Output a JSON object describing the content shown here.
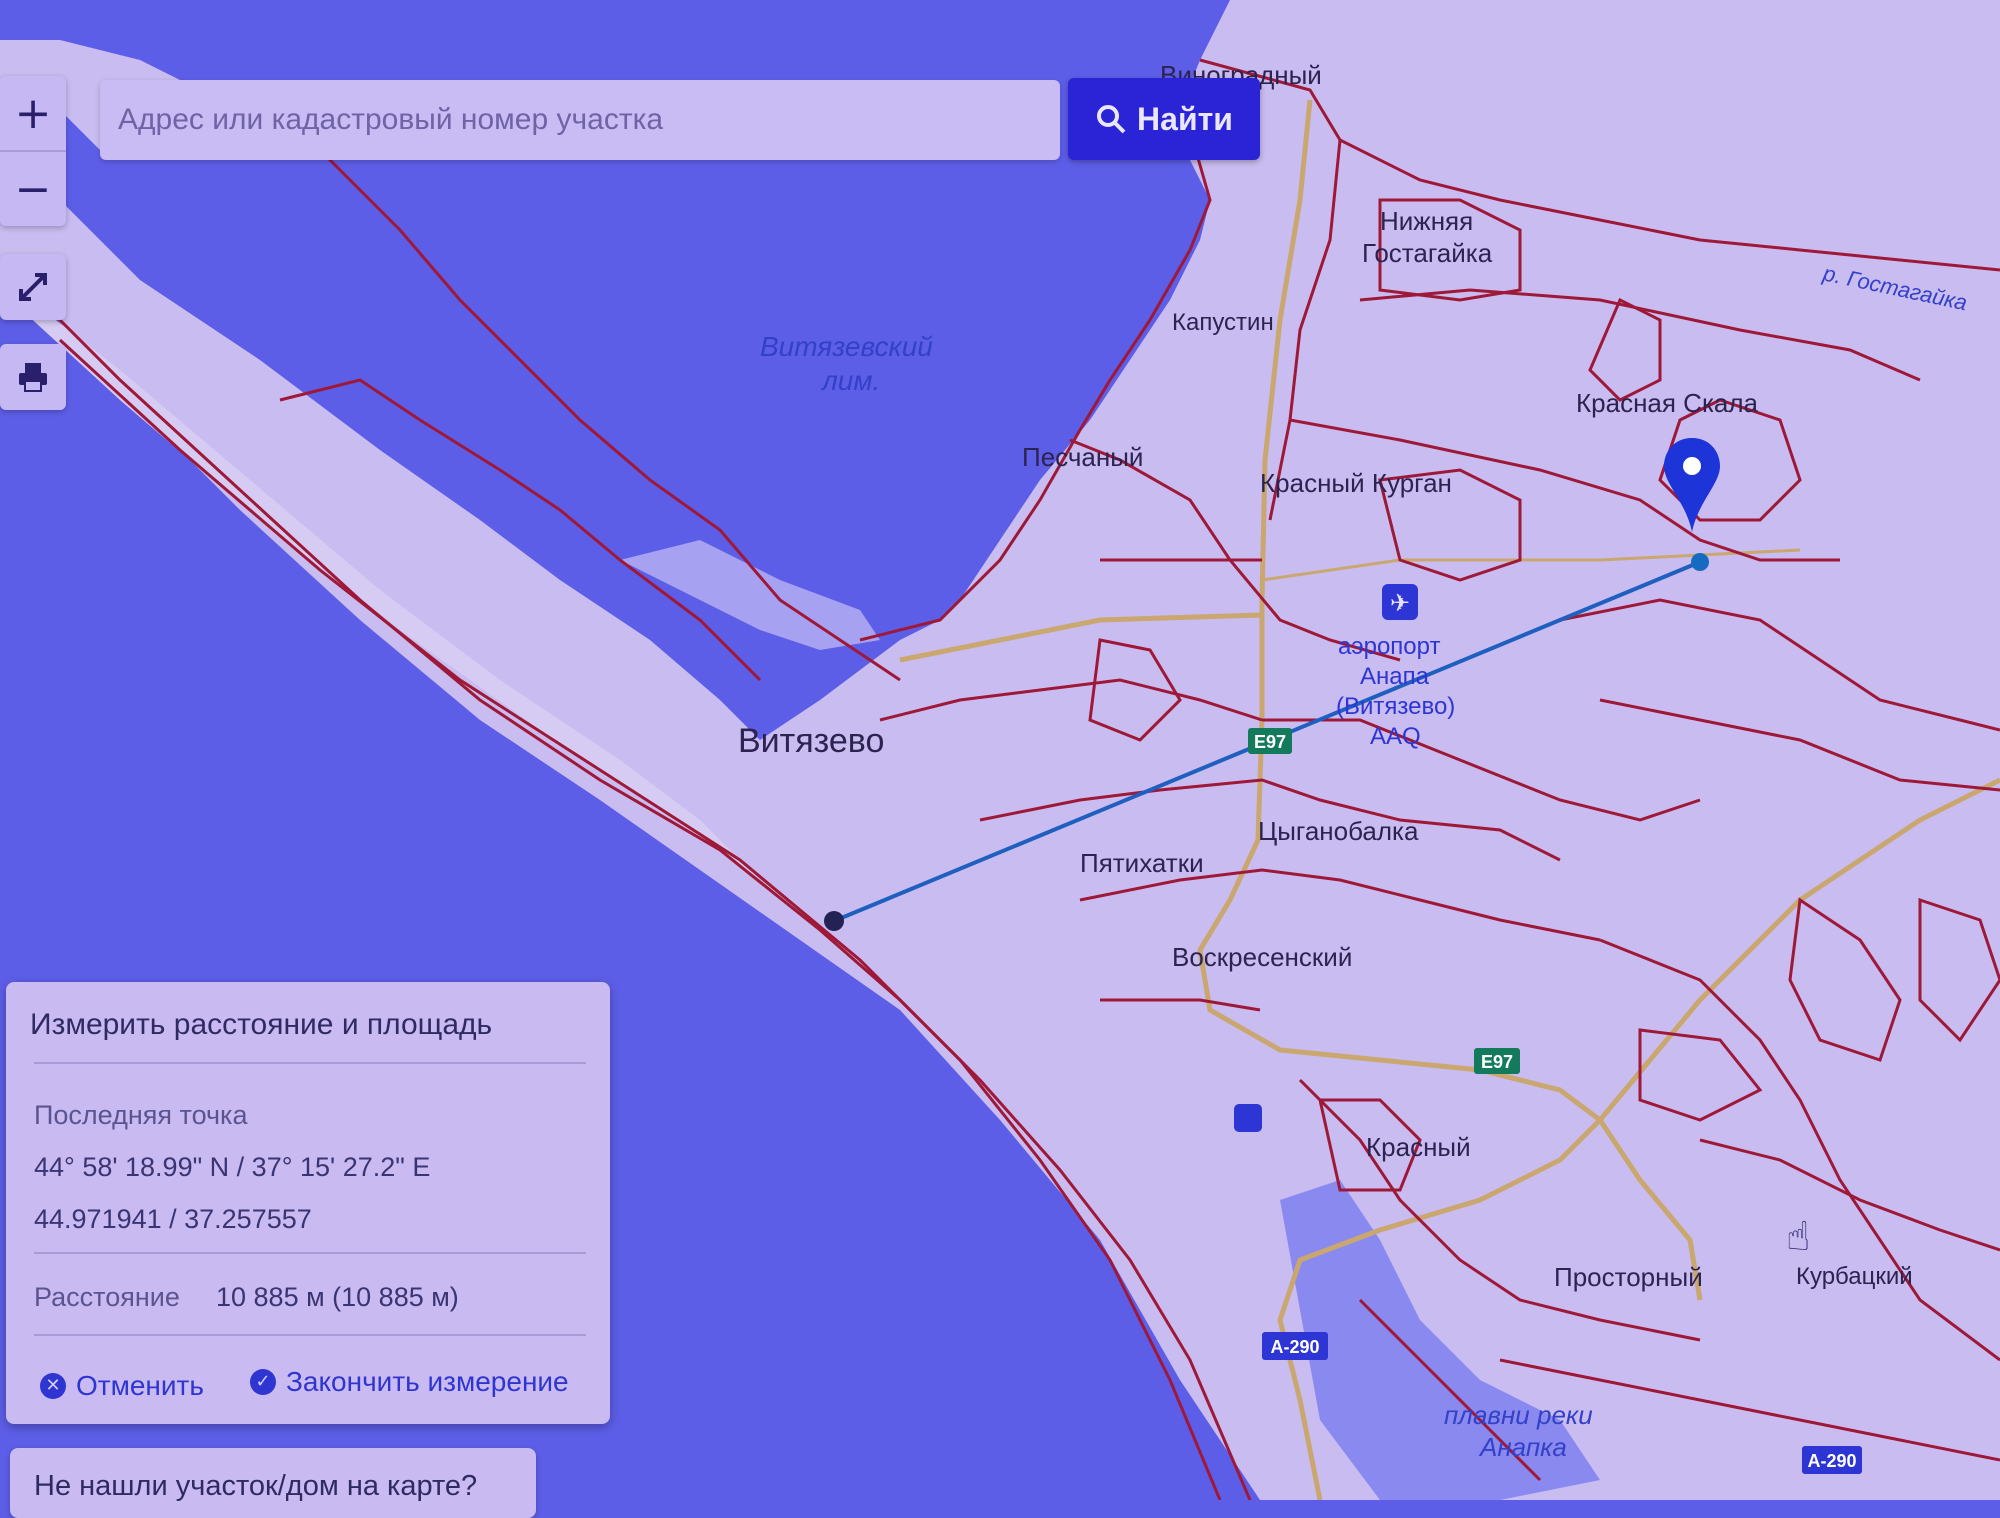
{
  "map": {
    "places": {
      "vinogradny": "Виноградный",
      "nizhnyaya": "Нижняя",
      "gostagayka": "Гостагайка",
      "kapustin": "Капустин",
      "krasnaya_skala": "Красная Скала",
      "peschany": "Песчаный",
      "krasny_kurgan": "Красный Курган",
      "vityazevo": "Витязево",
      "airport_l1": "аэропорт",
      "airport_l2": "Анапа",
      "airport_l3": "(Витязево)",
      "airport_l4": "AAQ",
      "tsyganobalka": "Цыганобалка",
      "pyatikhatki": "Пятихатки",
      "voskresensky": "Воскресенский",
      "krasny": "Красный",
      "prostorny": "Просторный",
      "kurbatsky": "Курбацкий"
    },
    "water": {
      "liman_l1": "Витязевский",
      "liman_l2": "лим.",
      "river": "р. Гостагайка",
      "plavni_l1": "плавни реки",
      "plavni_l2": "Анапка"
    },
    "roads": {
      "e97_a": "E97",
      "e97_b": "E97",
      "a290": "А-290",
      "a290_b": "А-290"
    },
    "colors": {
      "land": "#c9bcf0",
      "water": "#5d5ee8",
      "boundary": "#9e1838",
      "road": "#c9a76e",
      "measure_line": "#1f5fbf",
      "marker": "#1c34d8"
    }
  },
  "controls": {
    "zoom_in": "+",
    "zoom_out": "−",
    "fullscreen_icon": "expand-icon",
    "print_icon": "printer-icon"
  },
  "search": {
    "placeholder": "Адрес или кадастровый номер участка",
    "button_label": "Найти",
    "button_icon": "search-icon"
  },
  "measure": {
    "title": "Измерить расстояние и площадь",
    "last_point_label": "Последняя точка",
    "coords_dms": "44° 58' 18.99\" N / 37° 15' 27.2\" E",
    "coords_decimal": "44.971941 / 37.257557",
    "distance_label": "Расстояние",
    "distance_value": "10 885 м (10 885 м)",
    "cancel_label": "Отменить",
    "finish_label": "Закончить измерение"
  },
  "not_found": {
    "text": "Не нашли участок/дом на карте?"
  }
}
